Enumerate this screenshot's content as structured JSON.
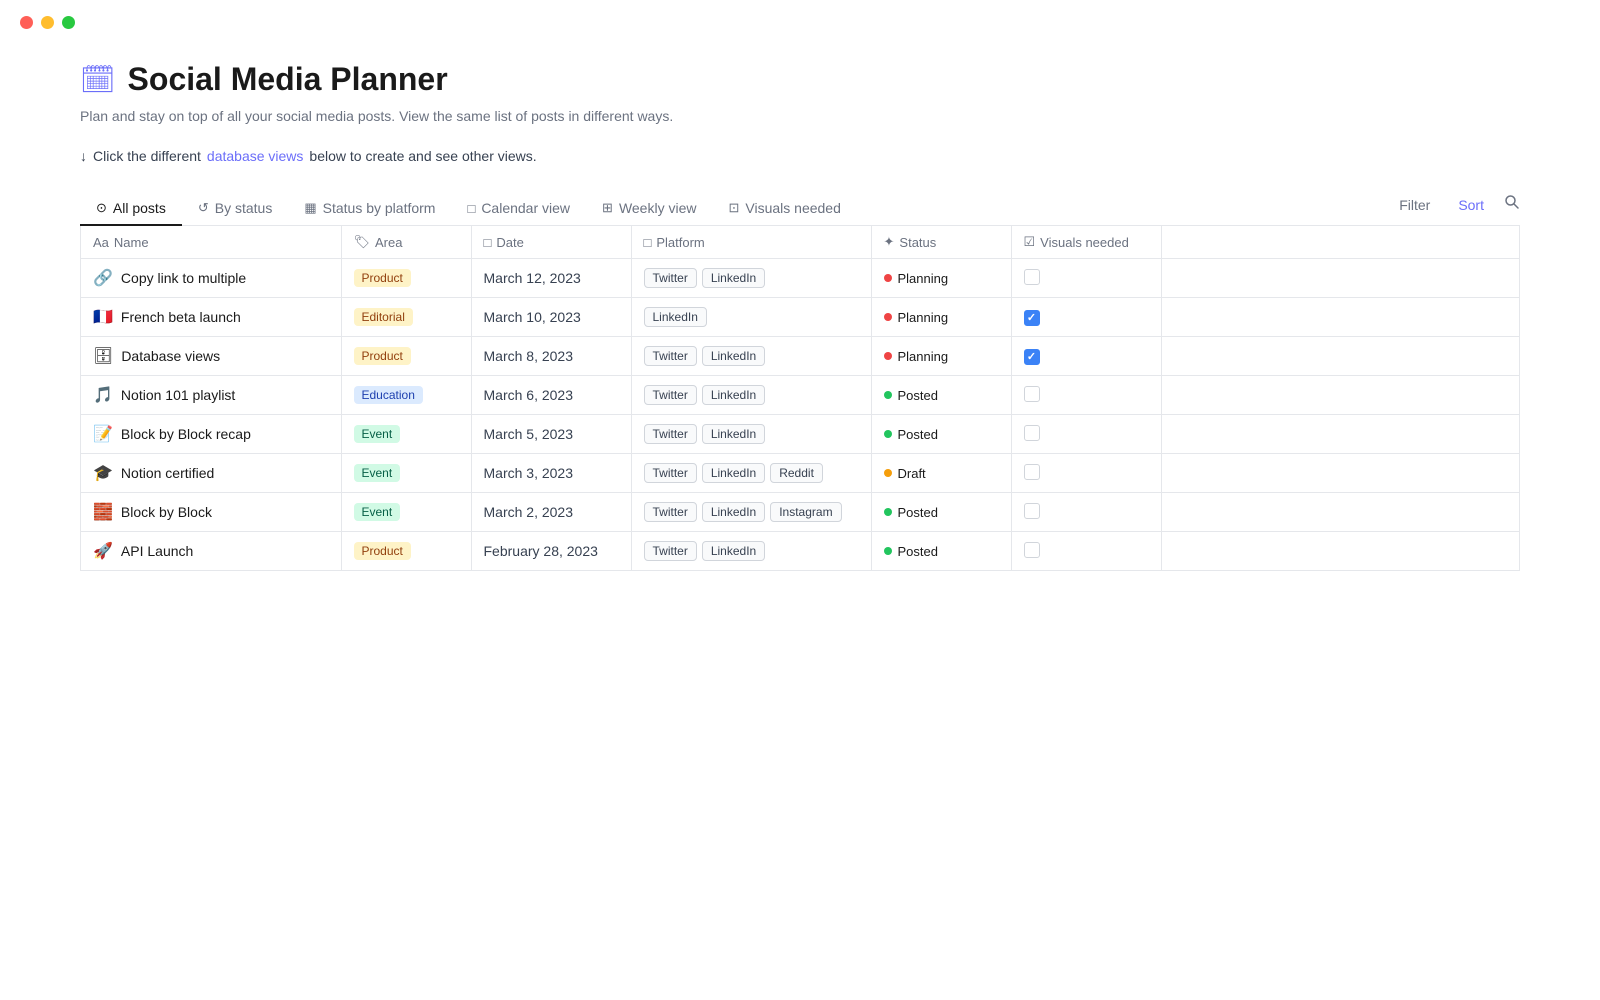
{
  "titlebar": {
    "lights": [
      "red",
      "yellow",
      "green"
    ]
  },
  "page": {
    "icon": "🗓",
    "title": "Social Media Planner",
    "description": "Plan and stay on top of all your social media posts. View the same list of posts in different ways.",
    "hint_arrow": "↓",
    "hint_text": "Click the different",
    "hint_link": "database views",
    "hint_suffix": "below to create and see other views."
  },
  "tabs": [
    {
      "id": "all-posts",
      "label": "All posts",
      "icon": "⊙",
      "active": true
    },
    {
      "id": "by-status",
      "label": "By status",
      "icon": "🔁",
      "active": false
    },
    {
      "id": "status-by-platform",
      "label": "Status by platform",
      "icon": "▦",
      "active": false
    },
    {
      "id": "calendar-view",
      "label": "Calendar view",
      "icon": "□",
      "active": false
    },
    {
      "id": "weekly-view",
      "label": "Weekly view",
      "icon": "⊞",
      "active": false
    },
    {
      "id": "visuals-needed",
      "label": "Visuals needed",
      "icon": "⊡",
      "active": false
    }
  ],
  "toolbar": {
    "filter_label": "Filter",
    "sort_label": "Sort"
  },
  "table": {
    "columns": [
      {
        "id": "name",
        "icon": "Aa",
        "label": "Name"
      },
      {
        "id": "area",
        "icon": "🏷",
        "label": "Area"
      },
      {
        "id": "date",
        "icon": "□",
        "label": "Date"
      },
      {
        "id": "platform",
        "icon": "□",
        "label": "Platform"
      },
      {
        "id": "status",
        "icon": "✦",
        "label": "Status"
      },
      {
        "id": "visuals",
        "icon": "☑",
        "label": "Visuals needed"
      }
    ],
    "rows": [
      {
        "id": 1,
        "emoji": "🔗",
        "name": "Copy link to multiple",
        "area": "Product",
        "area_class": "badge-product",
        "date": "March 12, 2023",
        "platforms": [
          "Twitter",
          "LinkedIn"
        ],
        "status": "Planning",
        "status_class": "status-planning",
        "visuals_checked": false
      },
      {
        "id": 2,
        "emoji": "🇫🇷",
        "name": "French beta launch",
        "area": "Editorial",
        "area_class": "badge-editorial",
        "date": "March 10, 2023",
        "platforms": [
          "LinkedIn"
        ],
        "status": "Planning",
        "status_class": "status-planning",
        "visuals_checked": true
      },
      {
        "id": 3,
        "emoji": "🗄",
        "name": "Database views",
        "area": "Product",
        "area_class": "badge-product",
        "date": "March 8, 2023",
        "platforms": [
          "Twitter",
          "LinkedIn"
        ],
        "status": "Planning",
        "status_class": "status-planning",
        "visuals_checked": true
      },
      {
        "id": 4,
        "emoji": "🎵",
        "name": "Notion 101 playlist",
        "area": "Education",
        "area_class": "badge-education",
        "date": "March 6, 2023",
        "platforms": [
          "Twitter",
          "LinkedIn"
        ],
        "status": "Posted",
        "status_class": "status-posted",
        "visuals_checked": false
      },
      {
        "id": 5,
        "emoji": "📝",
        "name": "Block by Block recap",
        "area": "Event",
        "area_class": "badge-event",
        "date": "March 5, 2023",
        "platforms": [
          "Twitter",
          "LinkedIn"
        ],
        "status": "Posted",
        "status_class": "status-posted",
        "visuals_checked": false
      },
      {
        "id": 6,
        "emoji": "🎓",
        "name": "Notion certified",
        "area": "Event",
        "area_class": "badge-event",
        "date": "March 3, 2023",
        "platforms": [
          "Twitter",
          "LinkedIn",
          "Reddit"
        ],
        "status": "Draft",
        "status_class": "status-draft",
        "visuals_checked": false
      },
      {
        "id": 7,
        "emoji": "🧱",
        "name": "Block by Block",
        "area": "Event",
        "area_class": "badge-event",
        "date": "March 2, 2023",
        "platforms": [
          "Twitter",
          "LinkedIn",
          "Instagram"
        ],
        "status": "Posted",
        "status_class": "status-posted",
        "visuals_checked": false
      },
      {
        "id": 8,
        "emoji": "🚀",
        "name": "API Launch",
        "area": "Product",
        "area_class": "badge-product",
        "date": "February 28, 2023",
        "platforms": [
          "Twitter",
          "LinkedIn"
        ],
        "status": "Posted",
        "status_class": "status-posted",
        "visuals_checked": false
      }
    ]
  }
}
